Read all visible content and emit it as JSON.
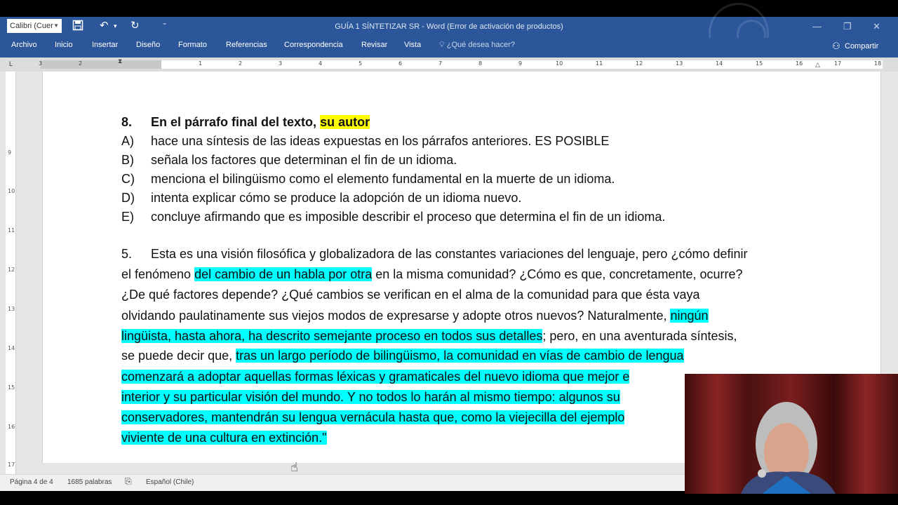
{
  "toolbar": {
    "font_name": "Calibri (Cuer",
    "title": "GUÍA 1 SÍNTETIZAR SR - Word (Error de activación de productos)",
    "save_icon": "save-icon",
    "undo_icon": "undo-icon",
    "redo_icon": "redo-icon"
  },
  "ribbon": {
    "tabs": [
      "Archivo",
      "Inicio",
      "Insertar",
      "Diseño",
      "Formato",
      "Referencias",
      "Correspondencia",
      "Revisar",
      "Vista"
    ],
    "tell_me": "¿Qué desea hacer?",
    "share": "Compartir"
  },
  "ruler": {
    "h_marks": [
      "3",
      "2",
      "1",
      "1",
      "2",
      "3",
      "4",
      "5",
      "6",
      "7",
      "8",
      "9",
      "10",
      "11",
      "12",
      "13",
      "14",
      "15",
      "16",
      "17",
      "18"
    ],
    "v_marks": [
      "9",
      "10",
      "11",
      "12",
      "13",
      "14",
      "15",
      "16",
      "17"
    ]
  },
  "document": {
    "q8": {
      "number": "8.",
      "stem": "En el párrafo final del texto, ",
      "stem_highlight": "su autor",
      "options": [
        {
          "letter": "A)",
          "text": "hace una síntesis de las ideas expuestas en los párrafos anteriores. ES POSIBLE"
        },
        {
          "letter": "B)",
          "text": "señala los factores que determinan el fin de un idioma."
        },
        {
          "letter": "C)",
          "text": "menciona el bilingüismo como el elemento fundamental en la muerte de un idioma."
        },
        {
          "letter": "D)",
          "text": "intenta explicar cómo se produce la adopción de un idioma nuevo."
        },
        {
          "letter": "E)",
          "text": "concluye afirmando que es imposible describir el proceso que determina el fin de un idioma."
        }
      ]
    },
    "p5": {
      "number": "5.",
      "l1": "Esta es una visión filosófica y globalizadora de las constantes variaciones del lenguaje, pero ¿cómo definir",
      "l2a": "el fenómeno ",
      "l2b": "del cambio de un habla por otra",
      "l2c": " en la misma comunidad? ¿Cómo es que, concretamente, ocurre?",
      "l3": "¿De qué factores depende? ¿Qué cambios se verifican en el alma de la comunidad para que ésta vaya",
      "l4a": "olvidando paulatinamente sus viejos modos de expresarse y adopte otros nuevos? Naturalmente, ",
      "l4b": "ningún",
      "l5a": "lingüista, hasta ahora, ha descrito semejante proceso en todos sus detalles",
      "l5b": "; pero, en una aventurada síntesis,",
      "l6a": "se puede decir que, ",
      "l6b": "tras un largo período de bilingüismo, la comunidad en vías de cambio de lengua",
      "l7": "comenzará a adoptar aquellas formas léxicas y gramaticales del nuevo idioma que mejor e",
      "l8": "interior y su particular visión del mundo. Y no todos lo harán al mismo tiempo: algunos su",
      "l9": "conservadores, mantendrán su lengua vernácula hasta que, como la viejecilla del ejemplo",
      "l10": "viviente de una cultura en extinción.\""
    }
  },
  "status": {
    "page": "Página 4 de 4",
    "words": "1685 palabras",
    "language": "Español (Chile)"
  },
  "colors": {
    "ribbon": "#2b579a",
    "highlight_yellow": "#ffff00",
    "highlight_cyan": "#00ffff"
  }
}
